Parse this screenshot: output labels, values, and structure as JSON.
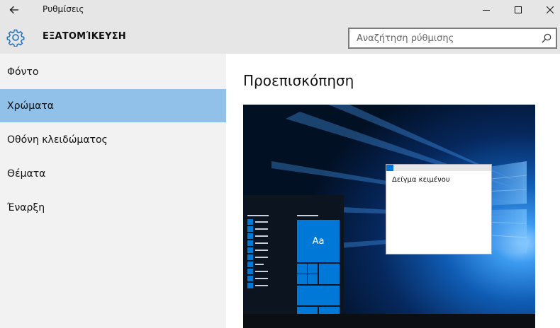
{
  "window": {
    "title": "Ρυθμίσεις",
    "back_icon": "arrow-left-icon",
    "controls": [
      "minimize-icon",
      "maximize-icon",
      "close-icon"
    ]
  },
  "header": {
    "icon": "gear-icon",
    "title": "ΕΞΑΤΟΜΊΚΕΥΣΗ",
    "search_placeholder": "Αναζήτηση ρύθμισης",
    "search_icon": "search-icon"
  },
  "sidebar": {
    "items": [
      {
        "label": "Φόντο",
        "active": false
      },
      {
        "label": "Χρώματα",
        "active": true
      },
      {
        "label": "Οθόνη κλειδώματος",
        "active": false
      },
      {
        "label": "Θέματα",
        "active": false
      },
      {
        "label": "Έναρξη",
        "active": false
      }
    ]
  },
  "main": {
    "section_title": "Προεπισκόπηση",
    "preview": {
      "tile_label": "Aa",
      "window_text": "Δείγμα κειμένου",
      "accent_color": "#0078d7"
    }
  },
  "colors": {
    "titlebar_bg": "#e6e6e6",
    "sidebar_bg": "#f2f2f2",
    "selected_bg": "#91c1e8",
    "accent": "#0078d7"
  }
}
